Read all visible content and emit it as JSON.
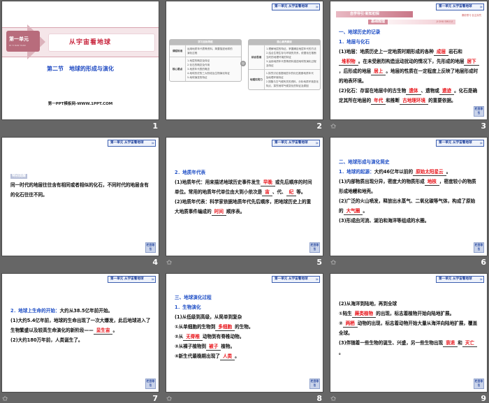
{
  "header_badge": "第一单元  从宇宙看地球",
  "nav_button": "栏目导引",
  "slides": [
    {
      "number": "1",
      "has_transition": false,
      "unit_tag": "第一单元",
      "unit_tag_sub": "DI YI DAN YUAN",
      "title": "从宇宙看地球",
      "subtitle": "第二节　地球的形成与演化",
      "footer": "第一PPT模板网-WWW.1PPT.COM"
    },
    {
      "number": "2",
      "has_transition": false,
      "left_table": {
        "caption": "学习目标导航",
        "rows": [
          {
            "key": "课程标准",
            "items": [
              "运用地质年代表等资料，简要描述地球的",
              "演化过程"
            ]
          },
          {
            "key": "核心要点",
            "items": [
              "1.地层的概念及特征",
              "2.化石的概念及作用",
              "3.地质年代表的概念",
              "4.地球历史的三大阶段及生物演化特征",
              "5.地球演变的特征"
            ]
          }
        ]
      },
      "center_icon": "◎",
      "right_table": {
        "caption": "核心素养解读",
        "rows": [
          {
            "key": "综合思维",
            "items": [
              "1.理解地层的特征，掌握确定地层年代的方法",
              "2.结合生物生存与环境的关系，依据化石推断",
              "  当时的地理环境的特征",
              "3.运用地质年代表等资料描述地球的演化过程",
              "  及特征"
            ]
          },
          {
            "key": "地理实践力",
            "items": [
              "1.探究讨论依据地层中的化石推断地质年代",
              "  及地理环境特征",
              "2.搜集与古气候有关的资料，分析地质环境变化",
              "  特点，探究地球气候变化的特征及原因"
            ]
          }
        ]
      }
    },
    {
      "number": "3",
      "has_transition": true,
      "banner": "自学导引·新知初探",
      "banner_right": "课前预习·自主探究",
      "sub_banner": "基础梳理",
      "sub_banner_pinyin": "JI CHU SHU LI",
      "lines": [
        [
          {
            "t": "一、地球历史的记录",
            "k": "h"
          }
        ],
        [
          {
            "t": "1．地层与化石",
            "k": "h"
          }
        ],
        [
          {
            "t": "(1)地层：地质历史上一定地质时期形成的各种",
            "k": "n"
          },
          {
            "t": "成层",
            "k": "b"
          },
          {
            "t": "岩石和",
            "k": "n"
          },
          {
            "t": "堆积物",
            "k": "b"
          },
          {
            "t": "。在未受剧烈构造运动扰动的情况下，先形成的地层",
            "k": "n"
          },
          {
            "t": "居下",
            "k": "b"
          },
          {
            "t": "，后形成的地层",
            "k": "n"
          },
          {
            "t": "居上",
            "k": "b"
          },
          {
            "t": "。地层的性质在一定程度上反映了地层形成时的地表环境。",
            "k": "n"
          }
        ],
        [
          {
            "t": "(2)化石：存留在地层中的古生物",
            "k": "n"
          },
          {
            "t": "遗体",
            "k": "b"
          },
          {
            "t": "、遗物或",
            "k": "n"
          },
          {
            "t": "遗迹",
            "k": "b"
          },
          {
            "t": "。化石是确定其所在地层的",
            "k": "n"
          },
          {
            "t": "年代",
            "k": "b"
          },
          {
            "t": "和推断",
            "k": "n"
          },
          {
            "t": "古地理环境",
            "k": "b"
          },
          {
            "t": "的重要依据。",
            "k": "n"
          }
        ]
      ]
    },
    {
      "number": "4",
      "has_transition": false,
      "tag": "特别提醒",
      "lines": [
        [
          {
            "t": "同一时代的地层往往含有相同或者相似的化石，不同时代的地层含有的化石往往不同。",
            "k": "n"
          }
        ]
      ]
    },
    {
      "number": "5",
      "has_transition": true,
      "lines": [
        [
          {
            "t": "2．地质年代表",
            "k": "h"
          }
        ],
        [
          {
            "t": "(1)地质年代：用来描述地球历史事件发生",
            "k": "n"
          },
          {
            "t": "早晚",
            "k": "b"
          },
          {
            "t": "或先后顺序的时间单位。常用的地质年代单位由大到小依次是",
            "k": "n"
          },
          {
            "t": "宙",
            "k": "b"
          },
          {
            "t": "、代、",
            "k": "n"
          },
          {
            "t": "纪",
            "k": "b"
          },
          {
            "t": "等。",
            "k": "n"
          }
        ],
        [
          {
            "t": "(2)地质年代表：科学家依据地质年代先后顺序，把地球历史上的重大地质事件编成的",
            "k": "n"
          },
          {
            "t": "时间",
            "k": "b"
          },
          {
            "t": "顺序表。",
            "k": "n"
          }
        ]
      ]
    },
    {
      "number": "6",
      "has_transition": true,
      "lines": [
        [
          {
            "t": "二、地球形成与演化简史",
            "k": "h"
          }
        ],
        [
          {
            "t": "1．地球的起源：",
            "k": "h"
          },
          {
            "t": "大约46亿年以前的",
            "k": "n"
          },
          {
            "t": "原始太阳星云",
            "k": "b"
          },
          {
            "t": "。",
            "k": "n"
          }
        ],
        [
          {
            "t": "(1)内部物质出现分异，密度大的物质形成",
            "k": "n"
          },
          {
            "t": "地核",
            "k": "b"
          },
          {
            "t": "，密度较小的物质形成地幔和地壳。",
            "k": "n"
          }
        ],
        [
          {
            "t": "(2)广泛的火山喷发，释放出水蒸气、二氧化碳等气体，构成了原始的",
            "k": "n"
          },
          {
            "t": "大气圈",
            "k": "b"
          },
          {
            "t": "。",
            "k": "n"
          }
        ],
        [
          {
            "t": "(3)形成由河流、湖泊和海洋等组成的水圈。",
            "k": "n"
          }
        ]
      ]
    },
    {
      "number": "7",
      "has_transition": true,
      "lines": [
        [
          {
            "t": "2．地球上生命的开始：",
            "k": "h"
          },
          {
            "t": "大约从38.5亿年前开始。",
            "k": "n"
          }
        ],
        [
          {
            "t": "(1)大约5.4亿年前，地球的生命出现了一次大爆发，此后地球进入了生物繁盛以及较高生命演化的新阶段——",
            "k": "n"
          },
          {
            "t": "显生宙",
            "k": "b"
          },
          {
            "t": "。",
            "k": "n"
          }
        ],
        [
          {
            "t": "(2)大约180万年前，人类诞生了。",
            "k": "n"
          }
        ]
      ]
    },
    {
      "number": "8",
      "has_transition": true,
      "lines": [
        [
          {
            "t": "三、地球演化过程",
            "k": "h"
          }
        ],
        [
          {
            "t": "1．生物演化",
            "k": "h"
          }
        ],
        [
          {
            "t": "(1)从低级到高级，从简单到复杂",
            "k": "n"
          }
        ],
        [
          {
            "t": "①从单细胞的生物到",
            "k": "n"
          },
          {
            "t": "多细胞",
            "k": "b"
          },
          {
            "t": "的生物。",
            "k": "n"
          }
        ],
        [
          {
            "t": "②从",
            "k": "n"
          },
          {
            "t": "无脊椎",
            "k": "b"
          },
          {
            "t": "动物到有脊椎动物。",
            "k": "n"
          }
        ],
        [
          {
            "t": "③从裸子植物到",
            "k": "n"
          },
          {
            "t": "被子",
            "k": "b"
          },
          {
            "t": "植物。",
            "k": "n"
          }
        ],
        [
          {
            "t": "④新生代最晚期出现了",
            "k": "n"
          },
          {
            "t": "人类",
            "k": "b"
          },
          {
            "t": "。",
            "k": "n"
          }
        ]
      ]
    },
    {
      "number": "9",
      "has_transition": true,
      "lines": [
        [
          {
            "t": "(2)从海洋到陆地，再到全球",
            "k": "n"
          }
        ],
        [
          {
            "t": "①陆生",
            "k": "n"
          },
          {
            "t": "蕨类植物",
            "k": "b"
          },
          {
            "t": "的出现，标志着植物开始向陆地扩展。",
            "k": "n"
          }
        ],
        [
          {
            "t": "②",
            "k": "n"
          },
          {
            "t": "两栖",
            "k": "b"
          },
          {
            "t": "动物的出现，标志着动物开始大量从海洋向陆地扩展，覆盖全球。",
            "k": "n"
          }
        ],
        [
          {
            "t": "(3)伴随着一些生物的诞生、兴盛，另一些生物出现",
            "k": "n"
          },
          {
            "t": "衰退",
            "k": "b"
          },
          {
            "t": "和",
            "k": "n"
          },
          {
            "t": "灭亡",
            "k": "b"
          },
          {
            "t": "。",
            "k": "n"
          }
        ]
      ]
    }
  ]
}
